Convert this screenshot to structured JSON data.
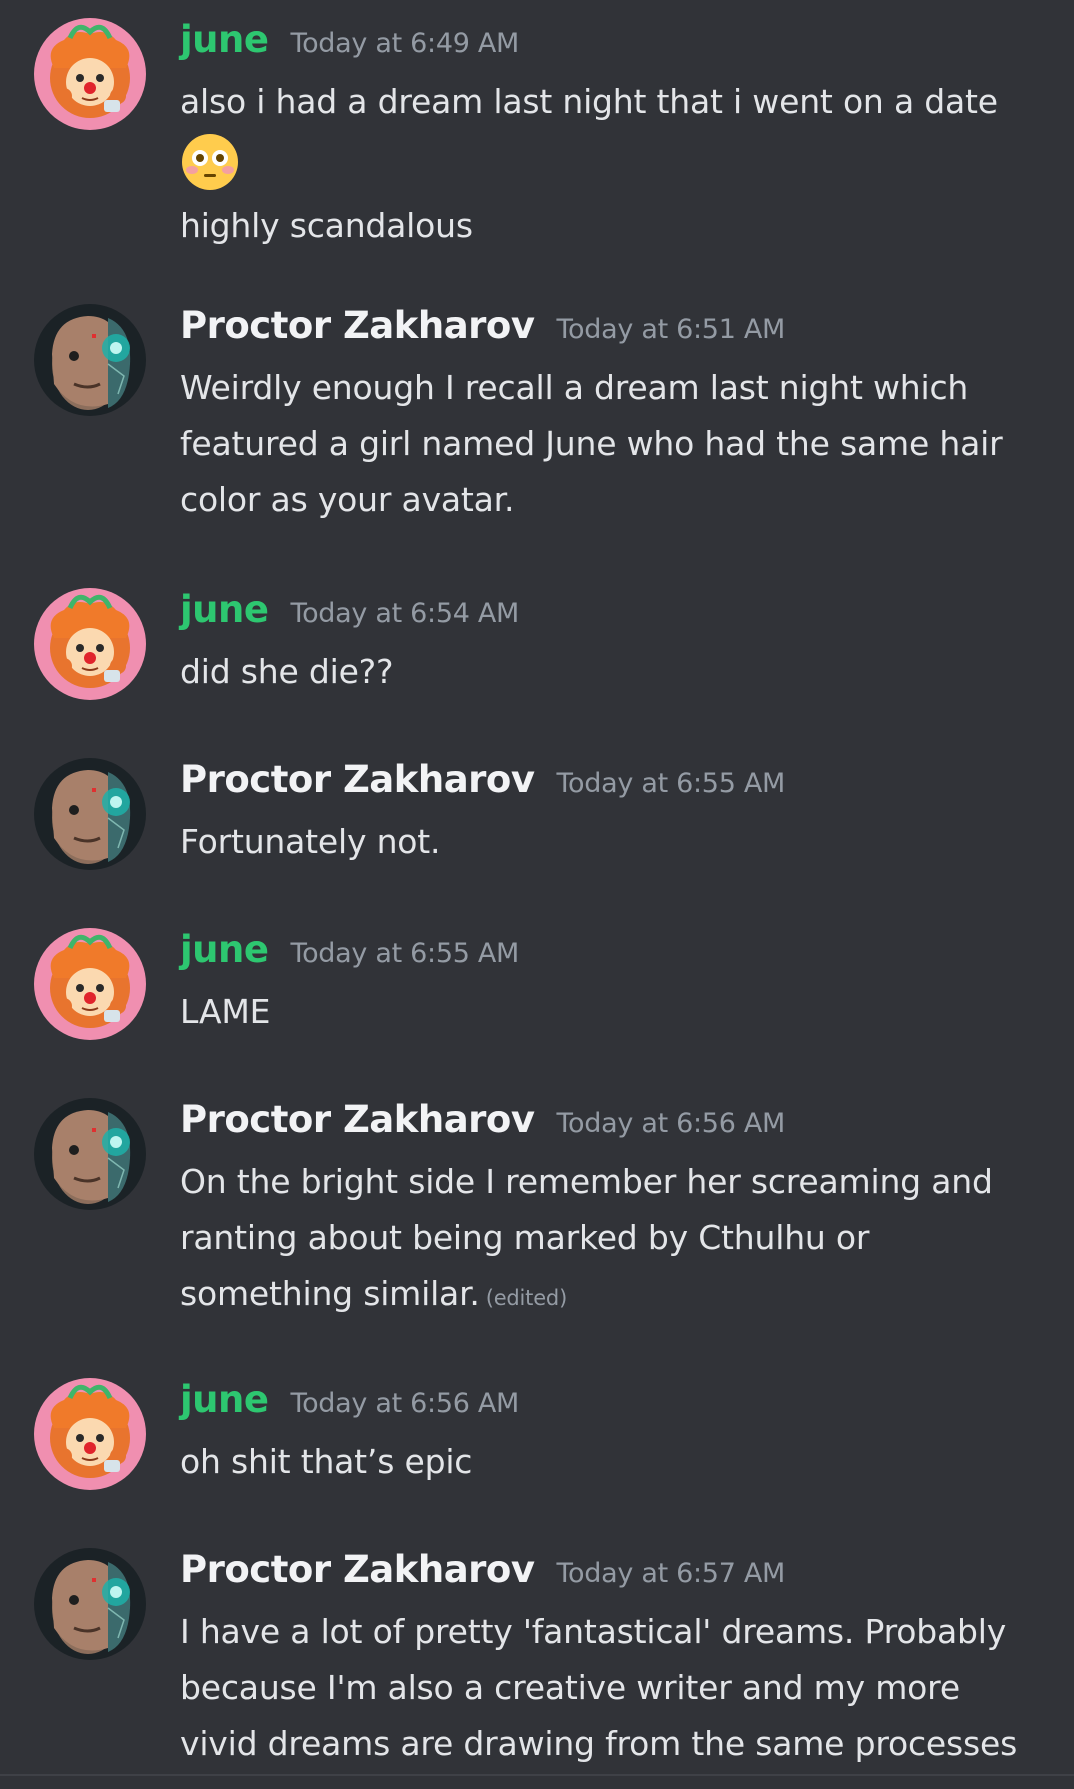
{
  "colors": {
    "background": "#313338",
    "june_name": "#2dc770",
    "proctor_name": "#f2f3f5",
    "timestamp": "#949ba4",
    "text": "#e3e5e8"
  },
  "messages": [
    {
      "author": "june",
      "timestamp": "Today at 6:49 AM",
      "avatar_icon": "june-avatar-icon",
      "lines": [
        "also i had a dream last night that i went on a date"
      ],
      "emoji": "flushed-face-icon",
      "after_emoji_lines": [
        "highly scandalous"
      ]
    },
    {
      "author": "Proctor Zakharov",
      "timestamp": "Today at 6:51 AM",
      "avatar_icon": "proctor-avatar-icon",
      "lines": [
        "Weirdly enough I recall a dream last night which",
        "featured a girl named June who had the same hair",
        "color as your avatar."
      ]
    },
    {
      "author": "june",
      "timestamp": "Today at 6:54 AM",
      "avatar_icon": "june-avatar-icon",
      "lines": [
        "did she die??"
      ]
    },
    {
      "author": "Proctor Zakharov",
      "timestamp": "Today at 6:55 AM",
      "avatar_icon": "proctor-avatar-icon",
      "lines": [
        "Fortunately not."
      ]
    },
    {
      "author": "june",
      "timestamp": "Today at 6:55 AM",
      "avatar_icon": "june-avatar-icon",
      "lines": [
        "LAME"
      ]
    },
    {
      "author": "Proctor Zakharov",
      "timestamp": "Today at 6:56 AM",
      "avatar_icon": "proctor-avatar-icon",
      "lines": [
        "On the bright side I remember her screaming and",
        "ranting about being marked by Cthulhu or",
        "something similar."
      ],
      "edited": "(edited)"
    },
    {
      "author": "june",
      "timestamp": "Today at 6:56 AM",
      "avatar_icon": "june-avatar-icon",
      "lines": [
        "oh shit that’s epic"
      ]
    },
    {
      "author": "Proctor Zakharov",
      "timestamp": "Today at 6:57 AM",
      "avatar_icon": "proctor-avatar-icon",
      "lines": [
        "I have a lot of pretty 'fantastical' dreams. Probably",
        "because I'm also a creative writer and my more",
        "vivid dreams are drawing from the same processes"
      ]
    }
  ]
}
